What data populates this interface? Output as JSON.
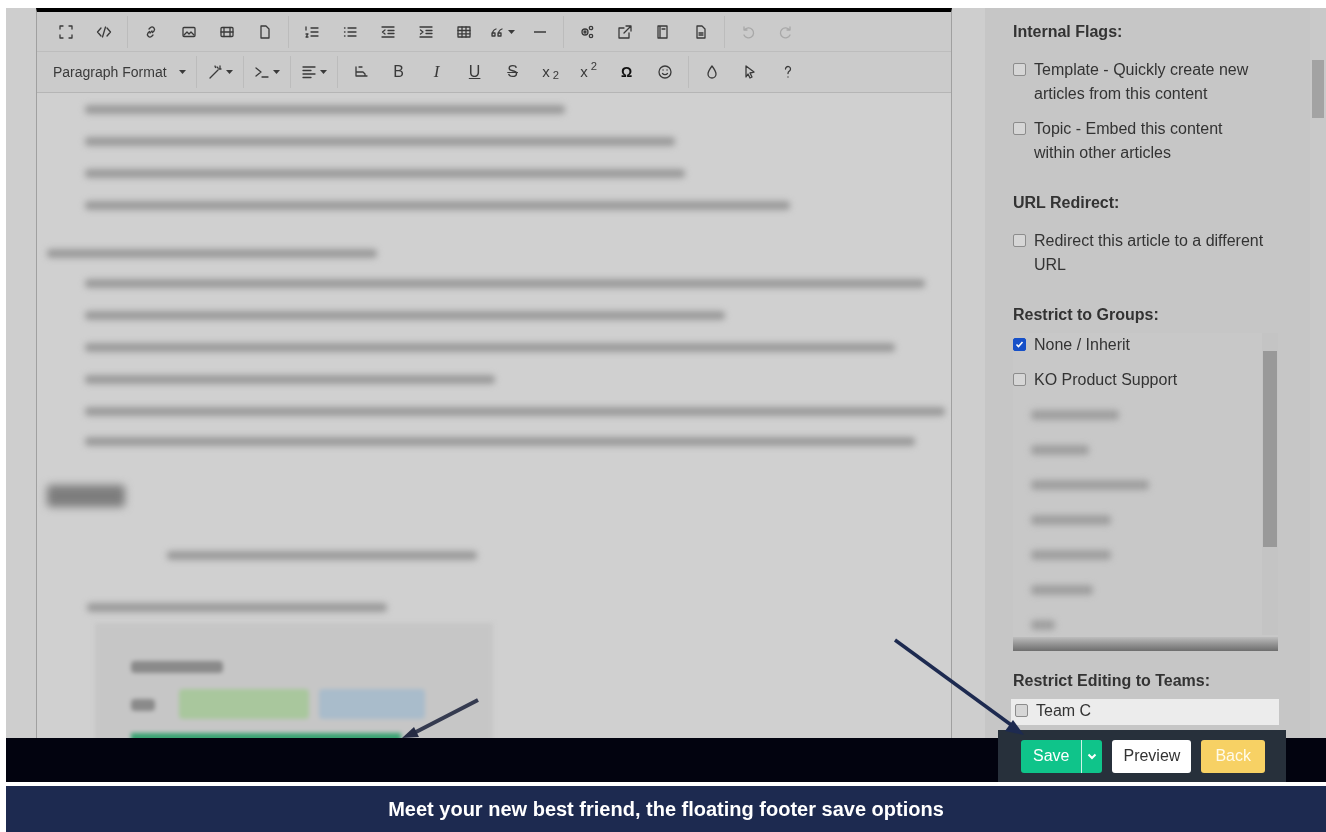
{
  "toolbar": {
    "rows": [
      [
        [
          {
            "kind": "icon",
            "disabled": false
          },
          {
            "kind": "icon",
            "disabled": false
          }
        ],
        [
          {
            "kind": "icon",
            "disabled": false
          },
          {
            "kind": "icon",
            "disabled": false
          },
          {
            "kind": "icon",
            "disabled": false
          },
          {
            "kind": "icon",
            "disabled": false
          }
        ],
        [
          {
            "kind": "icon",
            "disabled": false
          },
          {
            "kind": "icon",
            "disabled": false
          },
          {
            "kind": "icon",
            "disabled": false
          },
          {
            "kind": "icon",
            "disabled": false
          },
          {
            "kind": "icon",
            "disabled": false
          },
          {
            "kind": "icon",
            "disabled": false
          },
          {
            "kind": "icon",
            "disabled": false
          }
        ],
        [
          {
            "kind": "icon",
            "disabled": false
          },
          {
            "kind": "icon",
            "disabled": false
          },
          {
            "kind": "icon",
            "disabled": false
          },
          {
            "kind": "icon",
            "disabled": false
          }
        ],
        [
          {
            "kind": "icon",
            "disabled": true
          },
          {
            "kind": "icon",
            "disabled": true
          }
        ]
      ],
      [
        [
          {
            "kind": "select",
            "label": "Paragraph Format",
            "disabled": false
          }
        ],
        [
          {
            "kind": "icon",
            "disabled": false
          }
        ],
        [
          {
            "kind": "icon",
            "disabled": false
          }
        ],
        [
          {
            "kind": "icon",
            "disabled": false
          }
        ],
        [
          {
            "kind": "icon",
            "disabled": false
          },
          {
            "kind": "bold",
            "label": "B",
            "disabled": false
          },
          {
            "kind": "italic",
            "label": "I",
            "disabled": false
          },
          {
            "kind": "underline",
            "label": "U",
            "disabled": false
          },
          {
            "kind": "strike",
            "label": "S",
            "disabled": false
          },
          {
            "kind": "script",
            "label": "x$_{2}$",
            "disabled": false
          },
          {
            "kind": "script",
            "label": "x$^{2}$",
            "disabled": false
          },
          {
            "kind": "symbol",
            "label": "Ω",
            "disabled": false
          },
          {
            "kind": "icon",
            "disabled": false
          }
        ],
        [
          {
            "kind": "icon",
            "disabled": false
          },
          {
            "kind": "icon",
            "disabled": false
          },
          {
            "kind": "icon",
            "disabled": false
          }
        ]
      ]
    ]
  },
  "sidebar": {
    "sections": [
      {
        "heading": "Internal Flags:",
        "kind": "checklist",
        "options": [
          {
            "label": "Template - Quickly create new articles from this content",
            "checked": false
          },
          {
            "label": "Topic - Embed this content within other articles",
            "checked": false
          }
        ]
      },
      {
        "heading": "URL Redirect:",
        "kind": "checklist",
        "options": [
          {
            "label": "Redirect this article to a different URL",
            "checked": false
          }
        ]
      },
      {
        "heading": "Restrict to Groups:",
        "kind": "listbox",
        "options": [
          {
            "label": "None / Inherit",
            "checked": true
          },
          {
            "label": "KO Product Support",
            "checked": false
          }
        ]
      },
      {
        "heading": "Restrict Editing to Teams:",
        "kind": "listbox_short",
        "options": [
          {
            "label": "Team C",
            "checked": false
          }
        ]
      }
    ]
  },
  "footer": {
    "save": "Save",
    "preview": "Preview",
    "back": "Back"
  },
  "caption": "Meet your new best friend, the floating footer save options"
}
